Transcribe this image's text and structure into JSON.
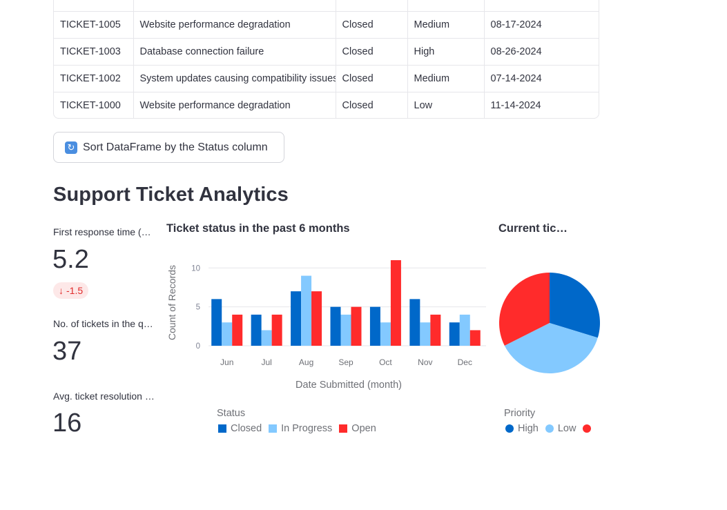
{
  "table": {
    "rows": [
      [
        "",
        "",
        "",
        "",
        ""
      ],
      [
        "TICKET-1005",
        "Website performance degradation",
        "Closed",
        "Medium",
        "08-17-2024"
      ],
      [
        "TICKET-1003",
        "Database connection failure",
        "Closed",
        "High",
        "08-26-2024"
      ],
      [
        "TICKET-1002",
        "System updates causing compatibility issues",
        "Closed",
        "Medium",
        "07-14-2024"
      ],
      [
        "TICKET-1000",
        "Website performance degradation",
        "Closed",
        "Low",
        "11-14-2024"
      ]
    ]
  },
  "sort_button": {
    "label": "Sort DataFrame by the Status column",
    "icon": "refresh-icon"
  },
  "section_title": "Support Ticket Analytics",
  "metrics": [
    {
      "label": "First response time (hours)",
      "value": "5.2",
      "delta": "-1.5",
      "delta_icon": "arrow-down-icon"
    },
    {
      "label": "No. of tickets in the queue",
      "value": "37"
    },
    {
      "label": "Avg. ticket resolution time (hours)",
      "value": "16"
    }
  ],
  "bar_chart": {
    "title": "Ticket status in the past 6 months",
    "legend_title": "Status"
  },
  "pie_chart": {
    "title": "Current ticket priority",
    "legend_title": "Priority"
  },
  "chart_data": [
    {
      "type": "bar",
      "title": "Ticket status in the past 6 months",
      "xlabel": "Date Submitted (month)",
      "ylabel": "Count of Records",
      "categories": [
        "Jun",
        "Jul",
        "Aug",
        "Sep",
        "Oct",
        "Nov",
        "Dec"
      ],
      "ylim": [
        0,
        11.8
      ],
      "yticks": [
        0,
        5,
        10
      ],
      "grid": true,
      "legend_position": "bottom-left",
      "series": [
        {
          "name": "Closed",
          "color": "#0068c9",
          "values": [
            6,
            4,
            7,
            5,
            5,
            6,
            3
          ]
        },
        {
          "name": "In Progress",
          "color": "#83c9ff",
          "values": [
            3,
            2,
            9,
            4,
            3,
            3,
            4
          ]
        },
        {
          "name": "Open",
          "color": "#ff2b2b",
          "values": [
            4,
            4,
            7,
            5,
            11,
            4,
            2
          ]
        }
      ]
    },
    {
      "type": "pie",
      "title": "Current ticket priority",
      "legend_position": "bottom",
      "slices": [
        {
          "name": "High",
          "color": "#0068c9",
          "value": 11
        },
        {
          "name": "Low",
          "color": "#83c9ff",
          "value": 14
        },
        {
          "name": "",
          "color": "#ff2b2b",
          "value": 12
        }
      ]
    }
  ]
}
